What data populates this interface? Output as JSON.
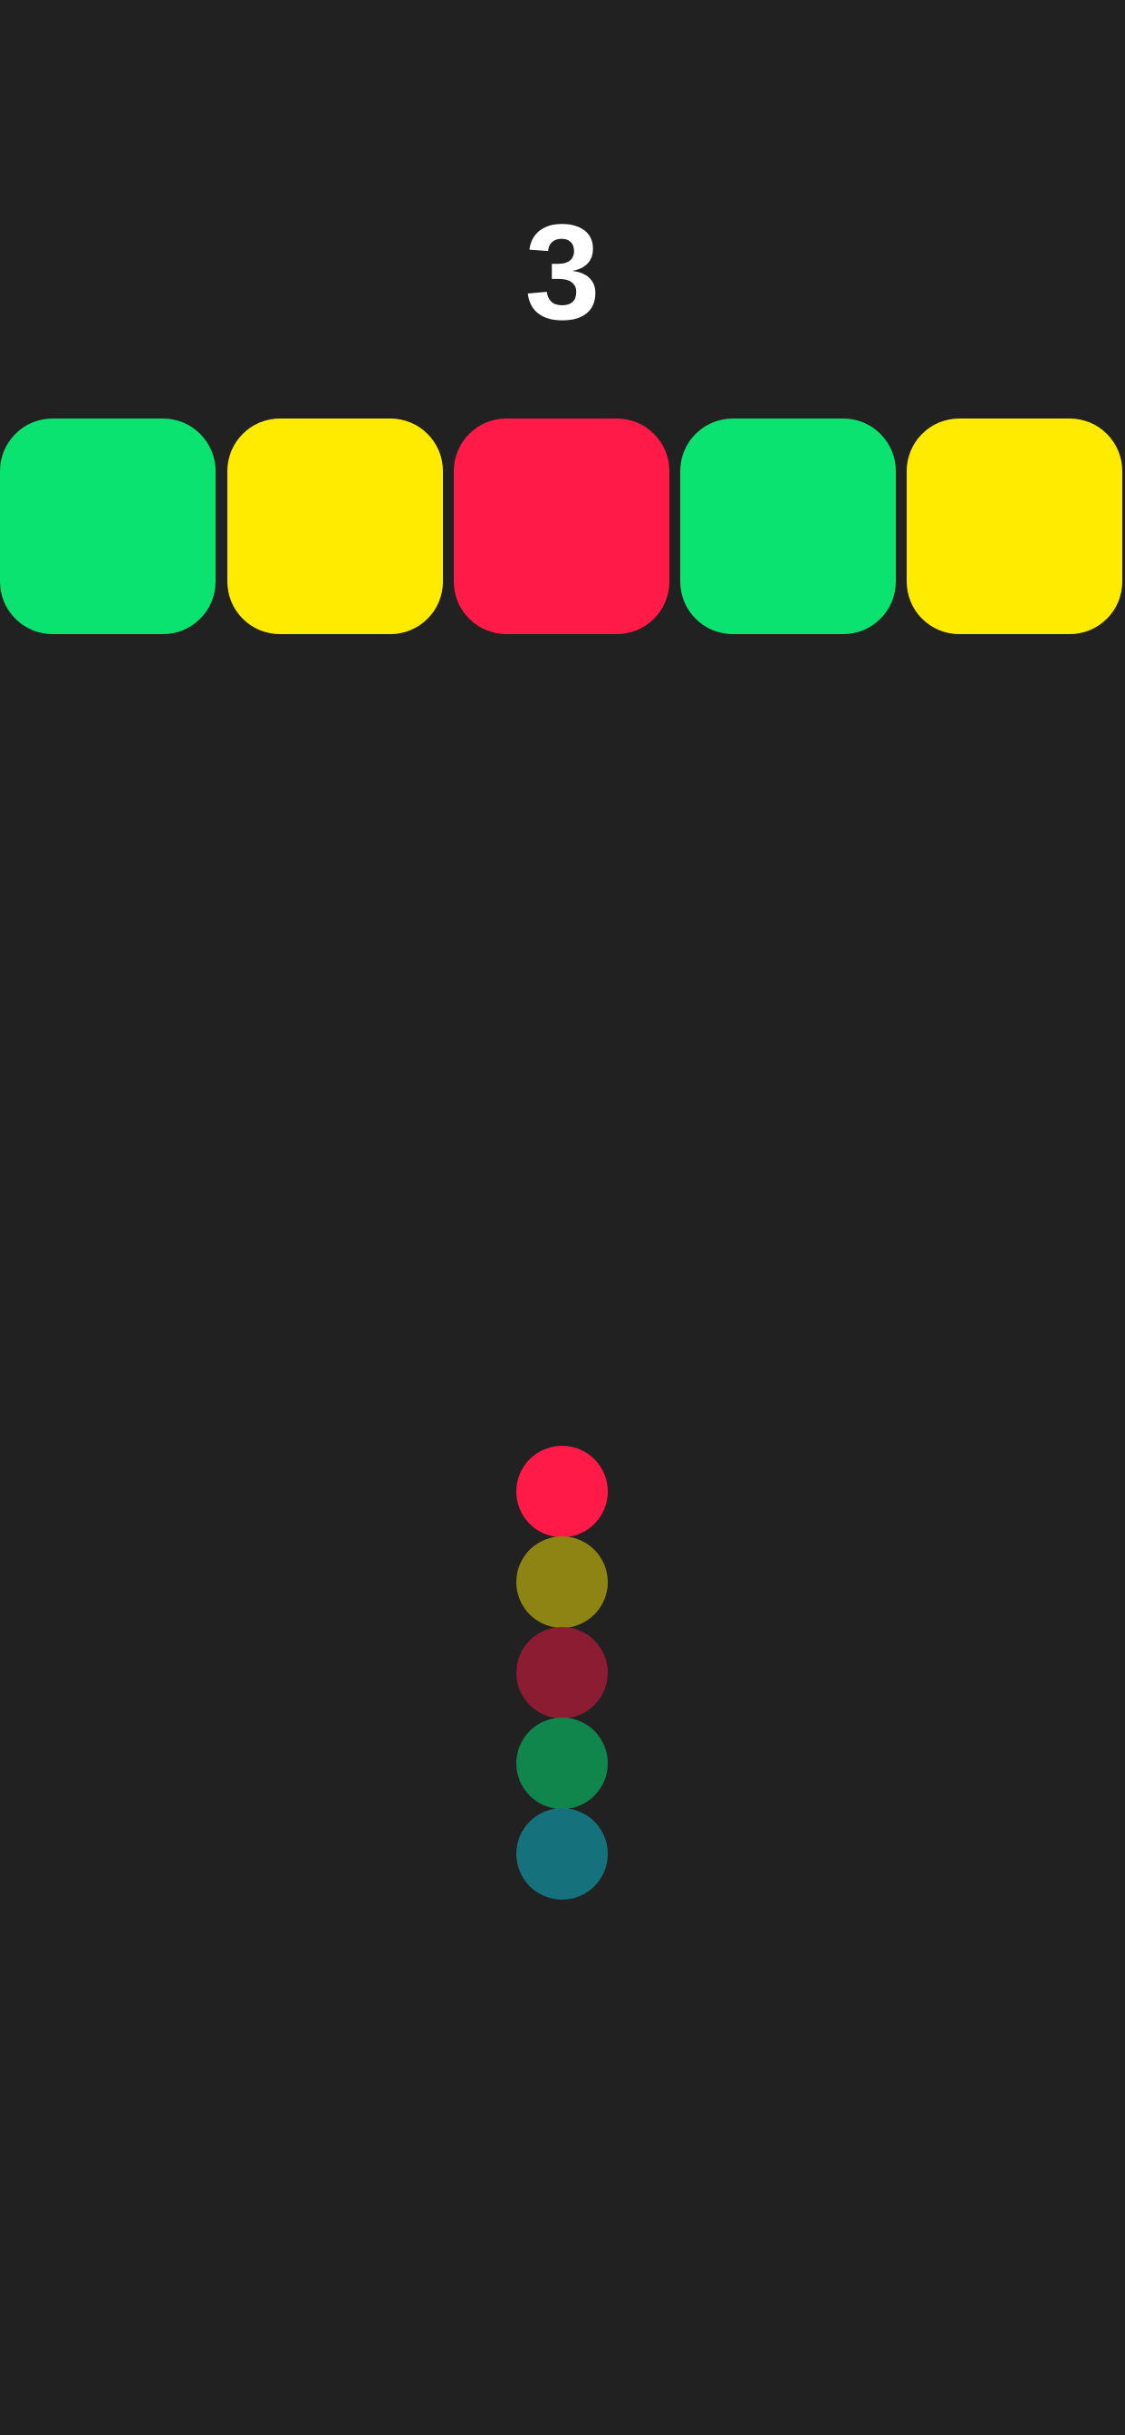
{
  "game": {
    "score": "3",
    "background_color": "#212121",
    "blocks": [
      {
        "color": "#0BE370"
      },
      {
        "color": "#FFEB00"
      },
      {
        "color": "#FF1A47"
      },
      {
        "color": "#0BE370"
      },
      {
        "color": "#FFEB00"
      }
    ],
    "snake": [
      {
        "color": "#FF1A47"
      },
      {
        "color": "#8E8414"
      },
      {
        "color": "#8B1C31"
      },
      {
        "color": "#10864D"
      },
      {
        "color": "#15727C"
      }
    ]
  }
}
